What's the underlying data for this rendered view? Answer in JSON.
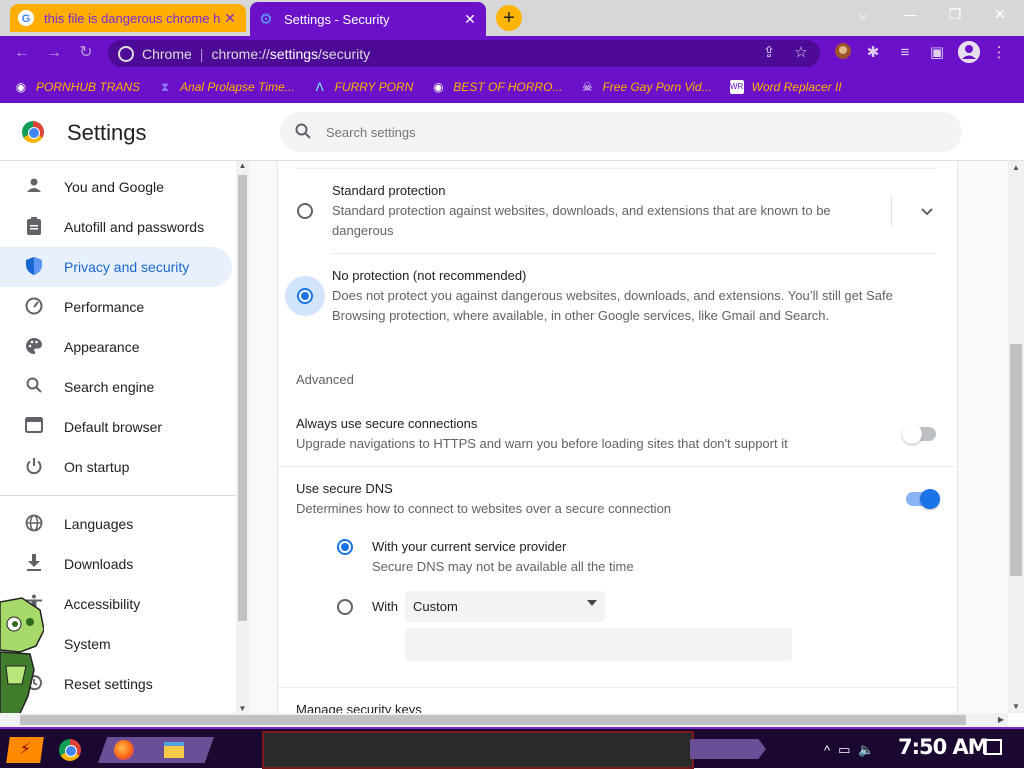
{
  "browser": {
    "tabs": [
      {
        "title": "this file is dangerous chrome h",
        "favicon": "google-g-icon",
        "active": false
      },
      {
        "title": "Settings - Security",
        "favicon": "gear-icon",
        "active": true
      }
    ],
    "new_tab": "+",
    "window_controls": {
      "dropdown": "⌵",
      "minimize": "—",
      "restore": "❐",
      "close": "✕"
    },
    "omnibox": {
      "site_label": "Chrome",
      "separator": "|",
      "url_prefix": "chrome://",
      "url_host": "settings",
      "url_path": "/security"
    },
    "bookmarks": [
      {
        "label": "PORNHUB TRANS",
        "icon": "globe-icon"
      },
      {
        "label": "Anal Prolapse Time...",
        "icon": "bookmark-icon"
      },
      {
        "label": "FURRY PORN",
        "icon": "lambda-icon"
      },
      {
        "label": "BEST OF HORRO...",
        "icon": "globe-icon"
      },
      {
        "label": "Free Gay Porn Vid...",
        "icon": "skull-icon"
      },
      {
        "label": "Word Replacer II",
        "icon": "wr-icon"
      }
    ],
    "accent_color": "#6a11c9",
    "tab_highlight_color": "#ffae00"
  },
  "settings": {
    "title": "Settings",
    "search_placeholder": "Search settings",
    "nav": [
      {
        "label": "You and Google",
        "icon": "person-icon"
      },
      {
        "label": "Autofill and passwords",
        "icon": "clipboard-icon"
      },
      {
        "label": "Privacy and security",
        "icon": "shield-icon",
        "active": true
      },
      {
        "label": "Performance",
        "icon": "speedometer-icon"
      },
      {
        "label": "Appearance",
        "icon": "palette-icon"
      },
      {
        "label": "Search engine",
        "icon": "search-icon"
      },
      {
        "label": "Default browser",
        "icon": "browser-icon"
      },
      {
        "label": "On startup",
        "icon": "power-icon"
      },
      {
        "label": "Languages",
        "icon": "globe-icon"
      },
      {
        "label": "Downloads",
        "icon": "download-icon"
      },
      {
        "label": "Accessibility",
        "icon": "accessibility-icon"
      },
      {
        "label": "System",
        "icon": "wrench-icon"
      },
      {
        "label": "Reset settings",
        "icon": "history-icon"
      }
    ],
    "protection": {
      "standard": {
        "title": "Standard protection",
        "desc_line1": "Standard protection against websites, downloads, and extensions that are known to be",
        "desc_line2": "dangerous",
        "checked": false
      },
      "none": {
        "title": "No protection (not recommended)",
        "desc_line1": "Does not protect you against dangerous websites, downloads, and extensions. You’ll still get Safe",
        "desc_line2": "Browsing protection, where available, in other Google services, like Gmail and Search.",
        "checked": true
      }
    },
    "advanced": {
      "heading": "Advanced",
      "https": {
        "title": "Always use secure connections",
        "desc": "Upgrade navigations to HTTPS and warn you before loading sites that don't support it",
        "enabled": false
      },
      "dns": {
        "title": "Use secure DNS",
        "desc": "Determines how to connect to websites over a secure connection",
        "enabled": true,
        "current_provider": {
          "title": "With your current service provider",
          "desc": "Secure DNS may not be available all the time",
          "checked": true
        },
        "custom": {
          "label": "With",
          "select_value": "Custom",
          "checked": false,
          "input_value": ""
        }
      },
      "security_keys": "Manage security keys"
    }
  },
  "taskbar": {
    "clock": "7:50 AM",
    "tray_icons": [
      "chevron-up-icon",
      "network-icon",
      "volume-icon"
    ]
  }
}
